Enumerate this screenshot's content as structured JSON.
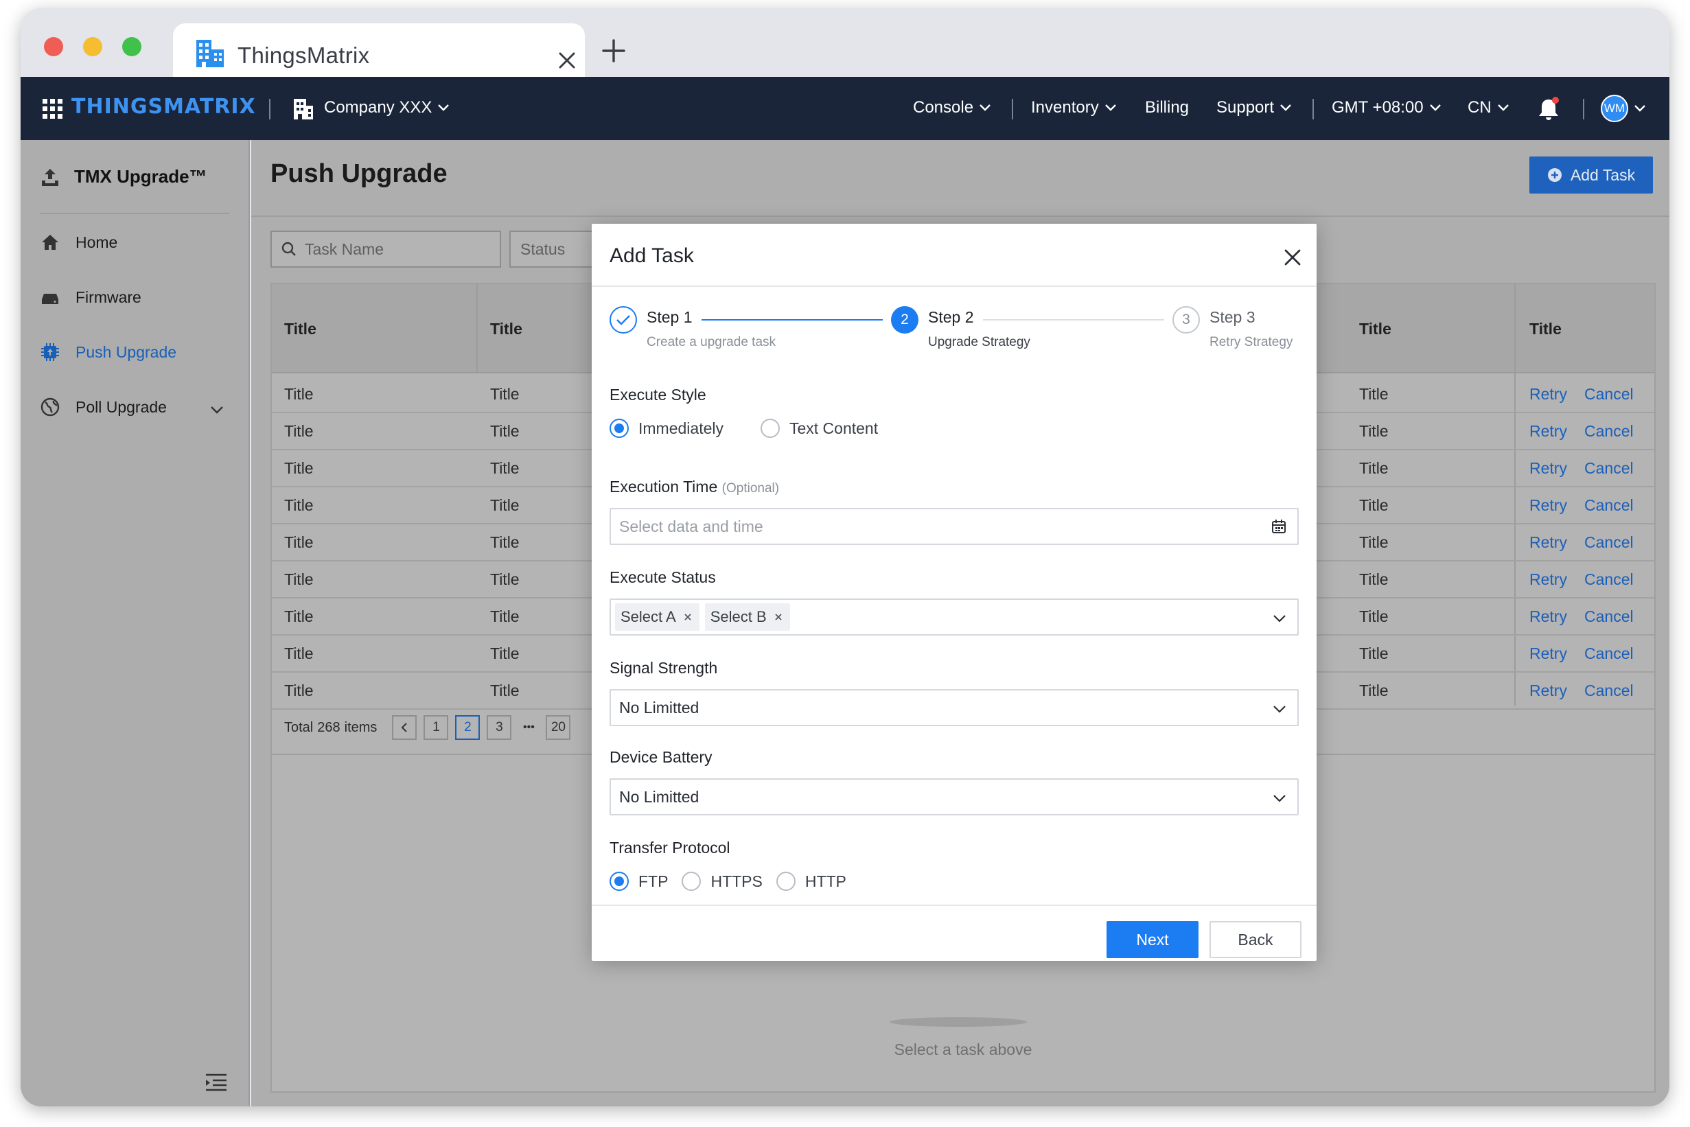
{
  "browser": {
    "tab_title": "ThingsMatrix"
  },
  "header": {
    "brand": "THINGSMATRIX",
    "company": "Company XXX",
    "nav": [
      "Console",
      "Inventory",
      "Billing",
      "Support",
      "GMT +08:00",
      "CN"
    ],
    "avatar_initials": "WM"
  },
  "sidebar": {
    "title": "TMX Upgrade™",
    "items": [
      {
        "label": "Home",
        "icon": "home-icon"
      },
      {
        "label": "Firmware",
        "icon": "firmware-icon"
      },
      {
        "label": "Push Upgrade",
        "icon": "push-upgrade-icon",
        "active": true
      },
      {
        "label": "Poll Upgrade",
        "icon": "globe-icon"
      }
    ]
  },
  "main": {
    "page_title": "Push Upgrade",
    "add_task_label": "Add Task",
    "filters": {
      "task_name_placeholder": "Task Name",
      "status_placeholder": "Status"
    },
    "table": {
      "headers": [
        "Title",
        "Title",
        "Title",
        "Title"
      ],
      "cell_text": "Title",
      "retry_label": "Retry",
      "cancel_label": "Cancel",
      "row_count": 9
    },
    "pager": {
      "total_prefix": "Total",
      "total": "268",
      "total_suffix": "items",
      "pages": [
        "1",
        "2",
        "3",
        "•••",
        "20"
      ],
      "current": "2"
    },
    "empty_text": "Select a task above"
  },
  "modal": {
    "title": "Add Task",
    "steps": [
      {
        "label": "Step 1",
        "desc": "Create a upgrade task",
        "num": "1",
        "state": "done"
      },
      {
        "label": "Step 2",
        "desc": "Upgrade Strategy",
        "num": "2",
        "state": "current"
      },
      {
        "label": "Step 3",
        "desc": "Retry Strategy",
        "num": "3",
        "state": "todo"
      }
    ],
    "execute_style": {
      "label": "Execute Style",
      "options": [
        "Immediately",
        "Text Content"
      ],
      "selected": "Immediately"
    },
    "execution_time": {
      "label": "Execution Time",
      "optional": "(Optional)",
      "placeholder": "Select data and time"
    },
    "execute_status": {
      "label": "Execute Status",
      "tags": [
        "Select A",
        "Select B"
      ]
    },
    "signal_strength": {
      "label": "Signal Strength",
      "value": "No Limitted"
    },
    "device_battery": {
      "label": "Device Battery",
      "value": "No Limitted"
    },
    "transfer_protocol": {
      "label": "Transfer Protocol",
      "options": [
        "FTP",
        "HTTPS",
        "HTTP"
      ],
      "selected": "FTP"
    },
    "next_label": "Next",
    "back_label": "Back"
  },
  "colors": {
    "header_bg": "#1a2539",
    "brand": "#3e92f0",
    "primary": "#1c7cf2",
    "active_link": "#1c5fb8"
  }
}
